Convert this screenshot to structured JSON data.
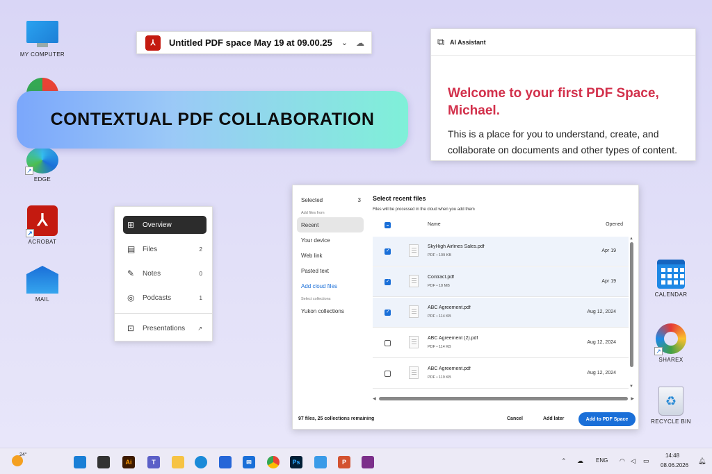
{
  "desktop_icons": {
    "my_computer": "MY COMPUTER",
    "edge": "EDGE",
    "acrobat": "ACROBAT",
    "mail": "MAIL",
    "calendar": "CALENDAR",
    "sharex": "SHAREX",
    "recycle_bin": "RECYCLE BIN"
  },
  "titlebar": {
    "title": "Untitled PDF space May 19 at 09.00.25",
    "chevron": "⌄",
    "cloud": "☁"
  },
  "banner": {
    "text": "CONTEXTUAL PDF COLLABORATION"
  },
  "ai_assistant": {
    "title": "AI Assistant",
    "welcome": "Welcome to your first PDF Space, Michael.",
    "body": "This is a place for you to understand, create, and collaborate on documents and other types of content."
  },
  "nav": {
    "items": [
      {
        "label": "Overview",
        "count": ""
      },
      {
        "label": "Files",
        "count": "2"
      },
      {
        "label": "Notes",
        "count": "0"
      },
      {
        "label": "Podcasts",
        "count": "1"
      },
      {
        "label": "Presentations",
        "count": ""
      }
    ]
  },
  "dialog": {
    "left": {
      "selected_label": "Selected",
      "selected_count": "3",
      "add_files_from": "Add files from",
      "recent": "Recent",
      "your_device": "Your device",
      "web_link": "Web link",
      "pasted_text": "Pasted text",
      "add_cloud_files": "Add cloud files",
      "select_collections": "Select collections",
      "yukon_collections": "Yukon collections"
    },
    "title": "Select recent files",
    "subtitle": "Files will be processed in the cloud when you add them",
    "col_name": "Name",
    "col_opened": "Opened",
    "files": [
      {
        "name": "SkyHigh Airlines Sales.pdf",
        "meta": "PDF • 109 KB",
        "date": "Apr 19",
        "checked": true
      },
      {
        "name": "Contract.pdf",
        "meta": "PDF • 18 MB",
        "date": "Apr 19",
        "checked": true
      },
      {
        "name": "ABC Agreement.pdf",
        "meta": "PDF • 114 KB",
        "date": "Aug 12, 2024",
        "checked": true
      },
      {
        "name": "ABC Agreement (2).pdf",
        "meta": "PDF • 114 KB",
        "date": "Aug 12, 2024",
        "checked": false
      },
      {
        "name": "ABC Agreement.pdf",
        "meta": "PDF • 119 KB",
        "date": "Aug 12, 2024",
        "checked": false
      }
    ],
    "status": "97 files, 25 collections remaining",
    "cancel": "Cancel",
    "add_later": "Add later",
    "add_to_space": "Add to PDF Space"
  },
  "taskbar": {
    "weather": "24°",
    "lang": "ENG",
    "time": "14:48",
    "date": "08.06.2026"
  }
}
